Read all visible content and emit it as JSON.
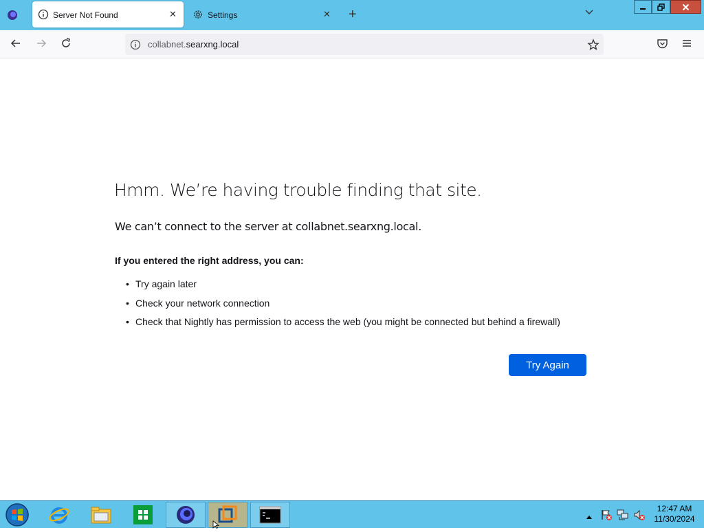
{
  "tabs": [
    {
      "title": "Server Not Found",
      "icon": "info-icon",
      "active": true
    },
    {
      "title": "Settings",
      "icon": "gear-icon",
      "active": false
    }
  ],
  "window_controls": {
    "minimize": "minimize-icon",
    "restore": "restore-icon",
    "close": "close-icon"
  },
  "nav": {
    "url_prefix": "collabnet.",
    "url_host": "searxng.local"
  },
  "error_page": {
    "title": "Hmm. We’re having trouble finding that site.",
    "description": "We can’t connect to the server at collabnet.searxng.local.",
    "subheading": "If you entered the right address, you can:",
    "suggestions": [
      "Try again later",
      "Check your network connection",
      "Check that Nightly has permission to access the web (you might be connected but behind a firewall)"
    ],
    "button": "Try Again",
    "button_color": "#0061e0"
  },
  "taskbar": {
    "items": [
      "start-orb-icon",
      "internet-explorer-icon",
      "file-explorer-icon",
      "store-icon",
      "firefox-nightly-icon",
      "vmware-icon",
      "command-prompt-icon"
    ],
    "clock_time": "12:47 AM",
    "clock_date": "11/30/2024"
  },
  "colors": {
    "chrome": "#5fc3ea",
    "accent": "#0061e0"
  }
}
